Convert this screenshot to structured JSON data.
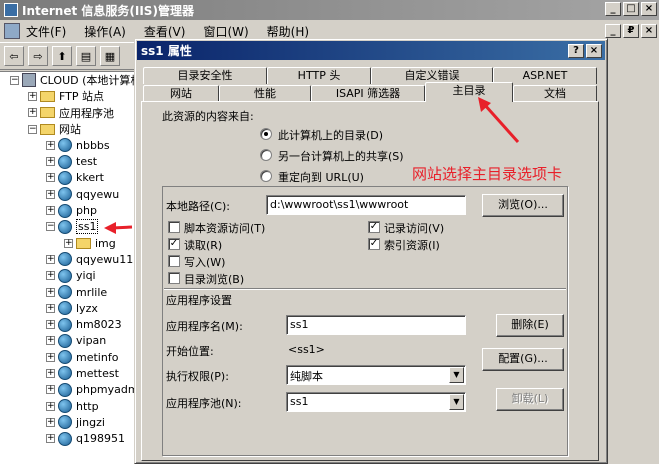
{
  "window": {
    "title": "Internet 信息服务(IIS)管理器",
    "buttons": [
      "_",
      "□",
      "×"
    ]
  },
  "menu": {
    "items": [
      "文件(F)",
      "操作(A)",
      "查看(V)",
      "窗口(W)",
      "帮助(H)"
    ],
    "mdi_buttons": [
      "_",
      "₽",
      "×"
    ]
  },
  "toolbar": {
    "buttons": [
      "back",
      "forward",
      "up",
      "show-hide-tree",
      "properties"
    ]
  },
  "tree": {
    "root": "CLOUD (本地计算机",
    "nodes": [
      "FTP 站点",
      "应用程序池",
      "网站"
    ],
    "sites": [
      "nbbbs",
      "test",
      "kkert",
      "qqyewu",
      "php",
      "ss1"
    ],
    "subfolder": "img",
    "sites2": [
      "qqyewu11",
      "yiqi",
      "mrlile",
      "lyzx",
      "hm8023",
      "vipan",
      "metinfo",
      "mettest",
      "phpmyadmi",
      "http",
      "jingzi",
      "q198951"
    ]
  },
  "dialog": {
    "title": "ss1 属性",
    "title_buttons": [
      "?",
      "×"
    ],
    "tabs_row1": [
      "目录安全性",
      "HTTP 头",
      "自定义错误",
      "ASP.NET"
    ],
    "tabs_row2": [
      "网站",
      "性能",
      "ISAPI 筛选器",
      "主目录",
      "文档"
    ],
    "source_label": "此资源的内容来自:",
    "radios": [
      "此计算机上的目录(D)",
      "另一台计算机上的共享(S)",
      "重定向到 URL(U)"
    ],
    "local_path_label": "本地路径(C):",
    "local_path_value": "d:\\wwwroot\\ss1\\wwwroot",
    "browse_button": "浏览(O)...",
    "checks_left": [
      "脚本资源访问(T)",
      "读取(R)",
      "写入(W)",
      "目录浏览(B)"
    ],
    "checks_left_state": [
      false,
      true,
      false,
      false
    ],
    "checks_right": [
      "记录访问(V)",
      "索引资源(I)"
    ],
    "checks_right_state": [
      true,
      true
    ],
    "app_settings_label": "应用程序设置",
    "app_name_label": "应用程序名(M):",
    "app_name_value": "ss1",
    "remove_button": "删除(E)",
    "start_label": "开始位置:",
    "start_value": "<ss1>",
    "config_button": "配置(G)...",
    "exec_perm_label": "执行权限(P):",
    "exec_perm_value": "纯脚本",
    "app_pool_label": "应用程序池(N):",
    "app_pool_value": "ss1",
    "unload_button": "卸载(L)"
  },
  "annotation": {
    "text": "网站选择主目录选项卡",
    "color": "#e8202a"
  }
}
